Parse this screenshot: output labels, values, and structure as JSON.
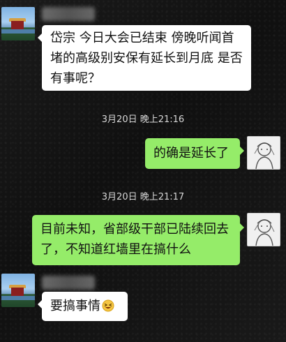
{
  "messages": [
    {
      "text": "岱宗 今日大会已结束 傍晚听闻首堵的高级别安保有延长到月底 是否有事呢？"
    },
    {
      "timestamp": "3月20日 晚上21:16"
    },
    {
      "text": "的确是延长了"
    },
    {
      "timestamp": "3月20日 晚上21:17"
    },
    {
      "text": "目前未知，省部级干部已陆续回去了，不知道红墙里在搞什么"
    },
    {
      "text": "要搞事情",
      "emoji": "grinning-squint-emoji"
    }
  ],
  "colors": {
    "incoming_bubble": "#ffffff",
    "outgoing_bubble": "#95ec69",
    "background": "#141414",
    "timestamp_text": "#d7d7d7"
  }
}
